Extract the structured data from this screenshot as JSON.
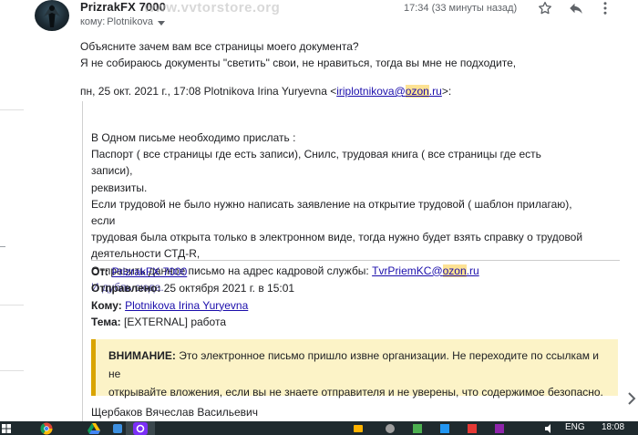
{
  "header": {
    "sender_name": "PrizrakFX 7000",
    "watermark": "www.vvtorstore.org",
    "to_prefix": "кому:",
    "to_name": "Plotnikova",
    "timestamp": "17:34 (33 минуты назад)"
  },
  "body": {
    "line1": "Объясните зачем вам все страницы моего документа?",
    "line2": "Я не собираюсь документы \"светить\" свои, не нравиться, тогда вы мне не подходите,"
  },
  "quote_header": {
    "prefix": "пн, 25 окт. 2021 г., 17:08 Plotnikova Irina Yuryevna <",
    "email_user": "iriplotnikova@",
    "email_domain_hl": "ozon",
    "email_tld": ".ru",
    "suffix": ">:"
  },
  "quoted": {
    "l1": "В Одном письме необходимо прислать :",
    "l2": "Паспорт ( все страницы где есть записи), Снилс, трудовая книга ( все страницы где есть записи),",
    "l3": "реквизиты.",
    "l4": "Если трудовой не было нужно написать заявление на открытие трудовой ( шаблон прилагаю), если",
    "l5": "трудовая была открыта только в электронном виде, тогда нужно будет взять справку о трудовой",
    "l6": "деятельности СТД-R,",
    "l7_prefix": "Отправить данное письмо на адрес кадровой службы: ",
    "l7_email_user": "TvrPriemKC@",
    "l7_email_domain_hl": "ozon",
    "l7_email_tld": ".ru",
    "l8": "И дубль сюда."
  },
  "meta": {
    "from_label": "От:",
    "from_value": "PrizrakFX 7000",
    "sent_label": "Отправлено:",
    "sent_value": "25 октября 2021 г. в 15:01",
    "to_label": "Кому:",
    "to_value": "Plotnikova Irina Yuryevna",
    "subject_label": "Тема:",
    "subject_value": "[EXTERNAL] работа"
  },
  "warning": {
    "title": "ВНИМАНИЕ:",
    "text1": " Это электронное письмо пришло извне организации. Не переходите по ссылкам и не",
    "text2": "открывайте вложения, если вы не знаете отправителя и не уверены, что содержимое безопасно."
  },
  "signature": "Щербаков Вячеслав Васильевич",
  "taskbar": {
    "lang": "ENG",
    "clock": "18:08"
  },
  "icons": {
    "star": "star-icon",
    "reply": "reply-icon",
    "more": "more-vert-icon"
  },
  "colors": {
    "link": "#1a0dab",
    "highlight": "#fde293",
    "warning_bg": "#fcf3c7",
    "warning_border": "#d9a400",
    "taskbar": "#1f2a2e"
  }
}
